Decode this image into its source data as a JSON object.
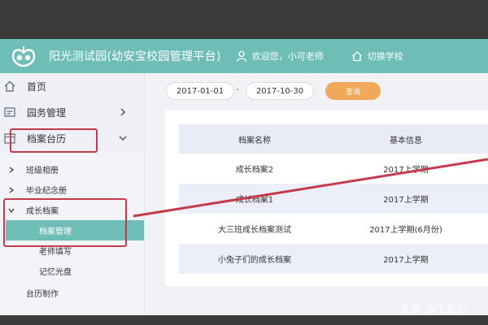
{
  "header": {
    "app_title": "阳光测试园(幼安宝校园管理平台)",
    "welcome": "欢迎您，小可老师",
    "switch_school": "切换学校"
  },
  "sidebar": {
    "home": "首页",
    "affairs": "园务管理",
    "archives": "档案台历",
    "sub_items": [
      {
        "label": "班级相册"
      },
      {
        "label": "毕业纪念册"
      },
      {
        "label": "成长档案"
      }
    ],
    "leaves": [
      "档案管理",
      "老师填写",
      "记忆光盘"
    ],
    "calendar": "台历制作"
  },
  "filter": {
    "start_date": "2017-01-01",
    "separator": "-",
    "end_date": "2017-10-30",
    "query": "查询"
  },
  "table": {
    "headers": [
      "档案名称",
      "基本信息"
    ],
    "rows": [
      [
        "成长档案2",
        "2017上学期"
      ],
      [
        "成长档案1",
        "2017上学期"
      ],
      [
        "大三班成长档案测试",
        "2017上学期(6月份)"
      ],
      [
        "小兔子们的成长档案",
        "2017上学期"
      ]
    ]
  },
  "watermark": "头条 @丁走心",
  "colors": {
    "header": "#6fbdb7",
    "query_button": "#f0a95a",
    "annotation": "#c43a4a"
  }
}
